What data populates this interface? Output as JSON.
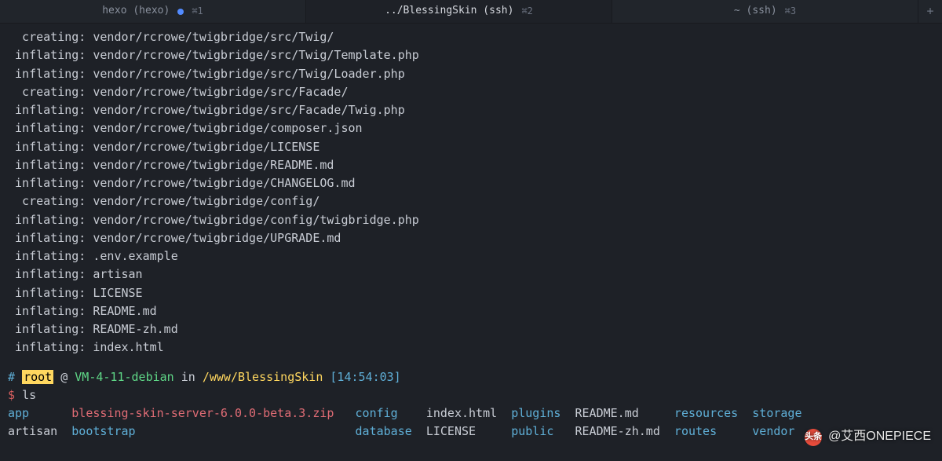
{
  "tabs": [
    {
      "title": "hexo (hexo)",
      "shortcut": "⌘1",
      "modified": true
    },
    {
      "title": "../BlessingSkin (ssh)",
      "shortcut": "⌘2",
      "modified": false
    },
    {
      "title": "~ (ssh)",
      "shortcut": "⌘3",
      "modified": false
    }
  ],
  "plus": "+",
  "output_lines": [
    "  creating: vendor/rcrowe/twigbridge/src/Twig/",
    " inflating: vendor/rcrowe/twigbridge/src/Twig/Template.php",
    " inflating: vendor/rcrowe/twigbridge/src/Twig/Loader.php",
    "  creating: vendor/rcrowe/twigbridge/src/Facade/",
    " inflating: vendor/rcrowe/twigbridge/src/Facade/Twig.php",
    " inflating: vendor/rcrowe/twigbridge/composer.json",
    " inflating: vendor/rcrowe/twigbridge/LICENSE",
    " inflating: vendor/rcrowe/twigbridge/README.md",
    " inflating: vendor/rcrowe/twigbridge/CHANGELOG.md",
    "  creating: vendor/rcrowe/twigbridge/config/",
    " inflating: vendor/rcrowe/twigbridge/config/twigbridge.php",
    " inflating: vendor/rcrowe/twigbridge/UPGRADE.md",
    " inflating: .env.example",
    " inflating: artisan",
    " inflating: LICENSE",
    " inflating: README.md",
    " inflating: README-zh.md",
    " inflating: index.html"
  ],
  "prompt": {
    "hash": "#",
    "user": "root",
    "at": "@",
    "host": "VM-4-11-debian",
    "in": "in",
    "path": "/www/BlessingSkin",
    "time": "[14:54:03]",
    "dollar": "$",
    "cmd": "ls"
  },
  "ls": {
    "row1": [
      {
        "text": "app",
        "color": "c-blue",
        "width": 9
      },
      {
        "text": "blessing-skin-server-6.0.0-beta.3.zip",
        "color": "c-red",
        "width": 40
      },
      {
        "text": "config",
        "color": "c-blue",
        "width": 10
      },
      {
        "text": "index.html",
        "color": "c-white",
        "width": 12
      },
      {
        "text": "plugins",
        "color": "c-blue",
        "width": 9
      },
      {
        "text": "README.md",
        "color": "c-white",
        "width": 14
      },
      {
        "text": "resources",
        "color": "c-blue",
        "width": 11
      },
      {
        "text": "storage",
        "color": "c-blue",
        "width": 8
      }
    ],
    "row2": [
      {
        "text": "artisan",
        "color": "c-white",
        "width": 9
      },
      {
        "text": "bootstrap",
        "color": "c-blue",
        "width": 40
      },
      {
        "text": "database",
        "color": "c-blue",
        "width": 10
      },
      {
        "text": "LICENSE",
        "color": "c-white",
        "width": 12
      },
      {
        "text": "public",
        "color": "c-blue",
        "width": 9
      },
      {
        "text": "README-zh.md",
        "color": "c-white",
        "width": 14
      },
      {
        "text": "routes",
        "color": "c-blue",
        "width": 11
      },
      {
        "text": "vendor",
        "color": "c-blue",
        "width": 8
      }
    ]
  },
  "watermark": {
    "icon": "头条",
    "text": "@艾西ONEPIECE"
  }
}
